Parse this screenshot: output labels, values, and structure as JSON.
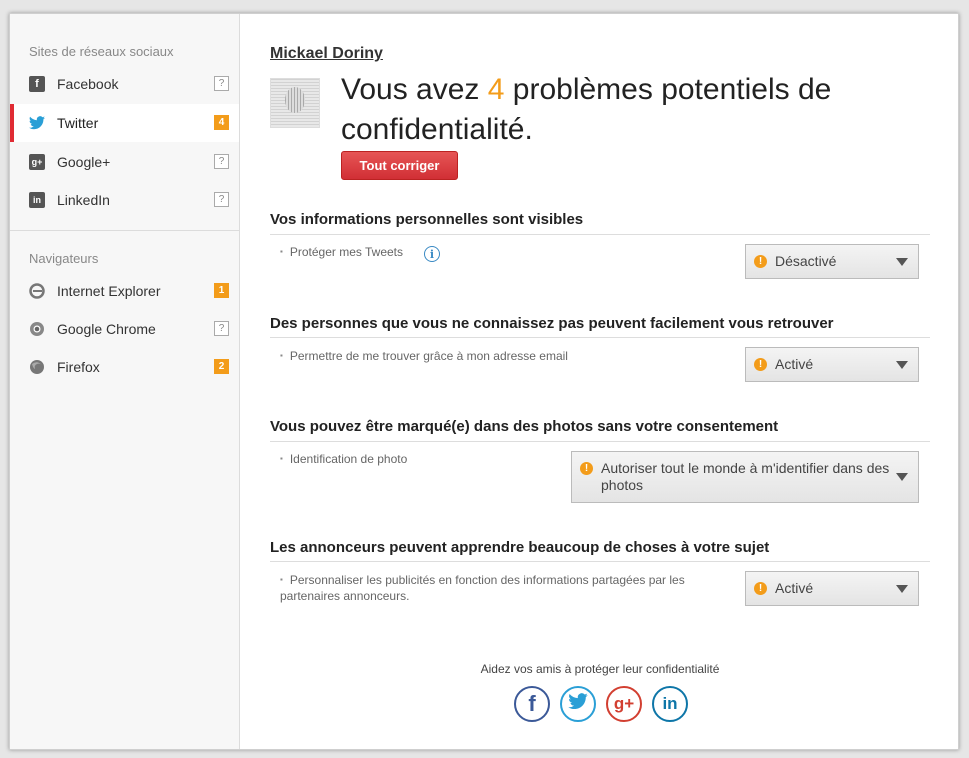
{
  "sidebar": {
    "social_heading": "Sites de réseaux sociaux",
    "social_items": [
      {
        "label": "Facebook",
        "badge": "?",
        "icon": "facebook-icon"
      },
      {
        "label": "Twitter",
        "badge": "4",
        "icon": "twitter-icon"
      },
      {
        "label": "Google+",
        "badge": "?",
        "icon": "google-plus-icon"
      },
      {
        "label": "LinkedIn",
        "badge": "?",
        "icon": "linkedin-icon"
      }
    ],
    "browser_heading": "Navigateurs",
    "browser_items": [
      {
        "label": "Internet Explorer",
        "badge": "1",
        "icon": "internet-explorer-icon"
      },
      {
        "label": "Google Chrome",
        "badge": "?",
        "icon": "chrome-icon"
      },
      {
        "label": "Firefox",
        "badge": "2",
        "icon": "firefox-icon"
      }
    ]
  },
  "header": {
    "user_name": "Mickael Doriny",
    "headline_before": "Vous avez ",
    "headline_count": "4",
    "headline_after": " problèmes potentiels de confidentialité.",
    "fix_all_label": "Tout corriger"
  },
  "sections": [
    {
      "title": "Vos informations personnelles sont visibles",
      "setting": "Protéger mes Tweets",
      "value": "Désactivé",
      "info_icon": "i"
    },
    {
      "title": "Des personnes que vous ne connaissez pas peuvent facilement vous retrouver",
      "setting": "Permettre de me trouver grâce à mon adresse email",
      "value": "Activé"
    },
    {
      "title": "Vous pouvez être marqué(e) dans des photos sans votre consentement",
      "setting": "Identification de photo",
      "value": "Autoriser tout le monde à m'identifier dans des photos"
    },
    {
      "title": "Les annonceurs peuvent apprendre beaucoup de choses à votre sujet",
      "setting": "Personnaliser les publicités en fonction des informations partagées par les partenaires annonceurs.",
      "value": "Activé"
    }
  ],
  "footer": {
    "share_text": "Aidez vos amis à protéger leur confidentialité",
    "share_buttons": [
      {
        "icon": "facebook-icon",
        "glyph": "f",
        "color": "#3b5998"
      },
      {
        "icon": "twitter-icon",
        "glyph": "",
        "color": "#2a9fd6"
      },
      {
        "icon": "google-plus-icon",
        "glyph": "g+",
        "color": "#d23f31"
      },
      {
        "icon": "linkedin-icon",
        "glyph": "in",
        "color": "#0e76a8"
      }
    ]
  },
  "colors": {
    "accent_red": "#e02b33",
    "badge_orange": "#f39c1a",
    "warning_orange": "#f39c1a"
  }
}
